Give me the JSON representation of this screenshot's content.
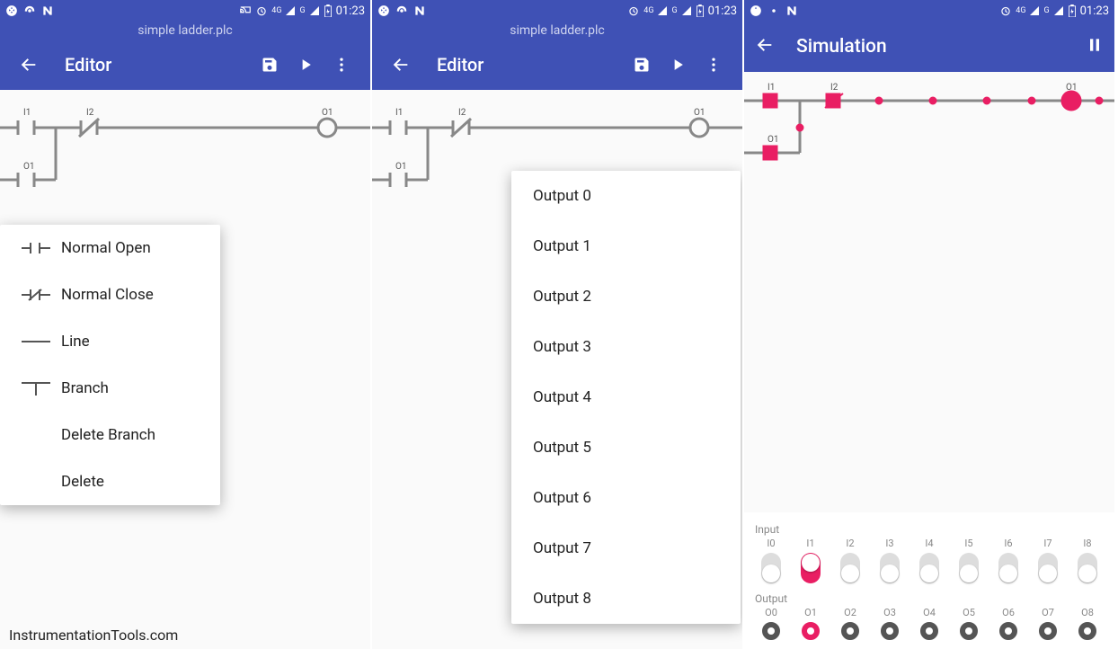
{
  "status": {
    "time": "01:23",
    "net": "4G",
    "net2": "G"
  },
  "file": {
    "name": "simple ladder.plc"
  },
  "editor": {
    "title": "Editor"
  },
  "ladder": {
    "i1": "I1",
    "i2": "I2",
    "o1": "O1",
    "branch_o1": "O1"
  },
  "editMenu": {
    "items": [
      {
        "label": "Normal Open"
      },
      {
        "label": "Normal Close"
      },
      {
        "label": "Line"
      },
      {
        "label": "Branch"
      },
      {
        "label": "Delete Branch"
      },
      {
        "label": "Delete"
      }
    ]
  },
  "outputMenu": {
    "items": [
      {
        "label": "Output 0"
      },
      {
        "label": "Output 1"
      },
      {
        "label": "Output 2"
      },
      {
        "label": "Output 3"
      },
      {
        "label": "Output 4"
      },
      {
        "label": "Output 5"
      },
      {
        "label": "Output 6"
      },
      {
        "label": "Output 7"
      },
      {
        "label": "Output 8"
      }
    ]
  },
  "sim": {
    "title": "Simulation",
    "inputLabel": "Input",
    "outputLabel": "Output",
    "inputs": [
      {
        "name": "I0",
        "on": false
      },
      {
        "name": "I1",
        "on": true
      },
      {
        "name": "I2",
        "on": false
      },
      {
        "name": "I3",
        "on": false
      },
      {
        "name": "I4",
        "on": false
      },
      {
        "name": "I5",
        "on": false
      },
      {
        "name": "I6",
        "on": false
      },
      {
        "name": "I7",
        "on": false
      },
      {
        "name": "I8",
        "on": false
      }
    ],
    "outputs": [
      {
        "name": "O0",
        "on": false
      },
      {
        "name": "O1",
        "on": true
      },
      {
        "name": "O2",
        "on": false
      },
      {
        "name": "O3",
        "on": false
      },
      {
        "name": "O4",
        "on": false
      },
      {
        "name": "O5",
        "on": false
      },
      {
        "name": "O6",
        "on": false
      },
      {
        "name": "O7",
        "on": false
      },
      {
        "name": "O8",
        "on": false
      }
    ]
  },
  "watermark": "InstrumentationTools.com",
  "colors": {
    "primary": "#3f51b5",
    "accent": "#e91e63"
  }
}
